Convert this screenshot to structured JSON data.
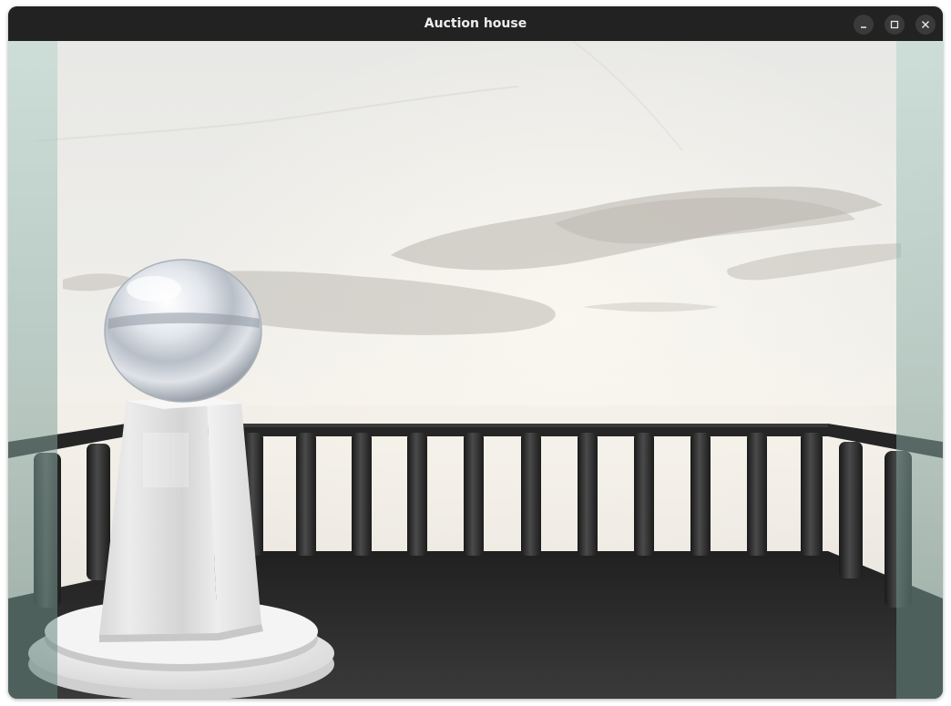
{
  "window": {
    "title": "Auction house",
    "controls": [
      "minimize-icon",
      "maximize-icon",
      "close-icon"
    ]
  },
  "scene": {
    "objects": [
      "sky",
      "clouds",
      "railing",
      "deck-floor",
      "pedestal",
      "chrome-sphere",
      "glass-panel-left",
      "glass-panel-right"
    ],
    "colors": {
      "sky_top": "#e9e9e7",
      "sky_horizon": "#f4efe6",
      "rail": "#2b2b2b",
      "floor": "#2a2a2a",
      "pedestal": "#e6e6e6",
      "glass_tint": "#a8c9c0"
    }
  }
}
